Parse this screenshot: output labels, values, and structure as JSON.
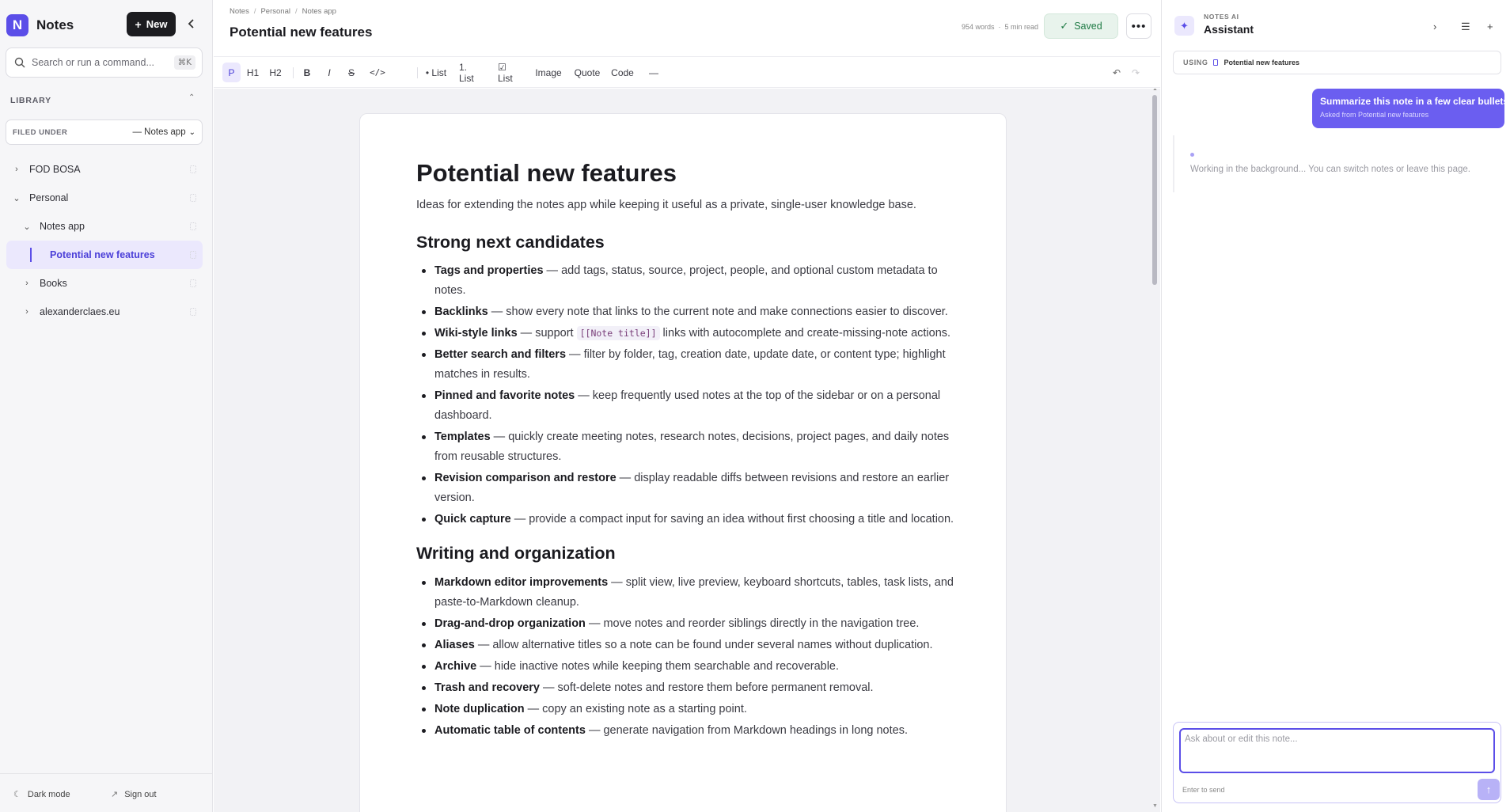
{
  "app": {
    "logo_letter": "N",
    "name": "Notes",
    "new_label": "New",
    "accent": "#5b4ee8"
  },
  "sidebar": {
    "search_placeholder": "Search or run a command...",
    "shortcut": "⌘K",
    "library_title": "LIBRARY",
    "filed_under_label": "FILED UNDER",
    "filed_under_value": "— Notes app",
    "tree": [
      {
        "label": "FOD BOSA",
        "level": 0,
        "expanded": false
      },
      {
        "label": "Personal",
        "level": 0,
        "expanded": true
      },
      {
        "label": "Notes app",
        "level": 1,
        "expanded": true
      },
      {
        "label": "Potential new features",
        "level": 2,
        "active": true
      },
      {
        "label": "Books",
        "level": 1,
        "expanded": false
      },
      {
        "label": "alexanderclaes.eu",
        "level": 1,
        "expanded": false
      }
    ],
    "footer": {
      "dark_mode": "Dark mode",
      "sign_out": "Sign out"
    }
  },
  "header": {
    "breadcrumb": [
      "Notes",
      "Personal",
      "Notes app"
    ],
    "title": "Potential new features",
    "word_count": "954 words",
    "read_time": "5 min read",
    "saved_label": "Saved"
  },
  "toolbar": {
    "items": [
      "P",
      "H1",
      "H2",
      "B",
      "I",
      "S",
      "</>",
      "• List",
      "1. List",
      "☑ List",
      "Image",
      "Quote",
      "Code",
      "—"
    ],
    "undo_icon": "undo-icon",
    "redo_icon": "redo-icon"
  },
  "document": {
    "title": "Potential new features",
    "intro": "Ideas for extending the notes app while keeping it useful as a private, single-user knowledge base.",
    "sections": [
      {
        "heading": "Strong next candidates",
        "items": [
          {
            "term": "Tags and properties",
            "text": " — add tags, status, source, project, people, and optional custom metadata to notes."
          },
          {
            "term": "Backlinks",
            "text": " — show every note that links to the current note and make connections easier to discover."
          },
          {
            "term": "Wiki-style links",
            "text_before": " — support ",
            "code": "[[Note title]]",
            "text": " links with autocomplete and create-missing-note actions."
          },
          {
            "term": "Better search and filters",
            "text": " — filter by folder, tag, creation date, update date, or content type; highlight matches in results."
          },
          {
            "term": "Pinned and favorite notes",
            "text": " — keep frequently used notes at the top of the sidebar or on a personal dashboard."
          },
          {
            "term": "Templates",
            "text": " — quickly create meeting notes, research notes, decisions, project pages, and daily notes from reusable structures."
          },
          {
            "term": "Revision comparison and restore",
            "text": " — display readable diffs between revisions and restore an earlier version."
          },
          {
            "term": "Quick capture",
            "text": " — provide a compact input for saving an idea without first choosing a title and location."
          }
        ]
      },
      {
        "heading": "Writing and organization",
        "items": [
          {
            "term": "Markdown editor improvements",
            "text": " — split view, live preview, keyboard shortcuts, tables, task lists, and paste-to-Markdown cleanup."
          },
          {
            "term": "Drag-and-drop organization",
            "text": " — move notes and reorder siblings directly in the navigation tree."
          },
          {
            "term": "Aliases",
            "text": " — allow alternative titles so a note can be found under several names without duplication."
          },
          {
            "term": "Archive",
            "text": " — hide inactive notes while keeping them searchable and recoverable."
          },
          {
            "term": "Trash and recovery",
            "text": " — soft-delete notes and restore them before permanent removal."
          },
          {
            "term": "Note duplication",
            "text": " — copy an existing note as a starting point."
          },
          {
            "term": "Automatic table of contents",
            "text": " — generate navigation from Markdown headings in long notes."
          }
        ]
      }
    ]
  },
  "assistant": {
    "kicker": "NOTES AI",
    "title": "Assistant",
    "using_label": "USING",
    "using_note": "Potential new features",
    "user_message": "Summarize this note in a few clear bullets.",
    "user_message_sub": "Asked from Potential new features",
    "working_text": "Working in the background... You can switch notes or leave this page.",
    "input_placeholder": "Ask about or edit this note...",
    "send_hint": "Enter to send"
  }
}
